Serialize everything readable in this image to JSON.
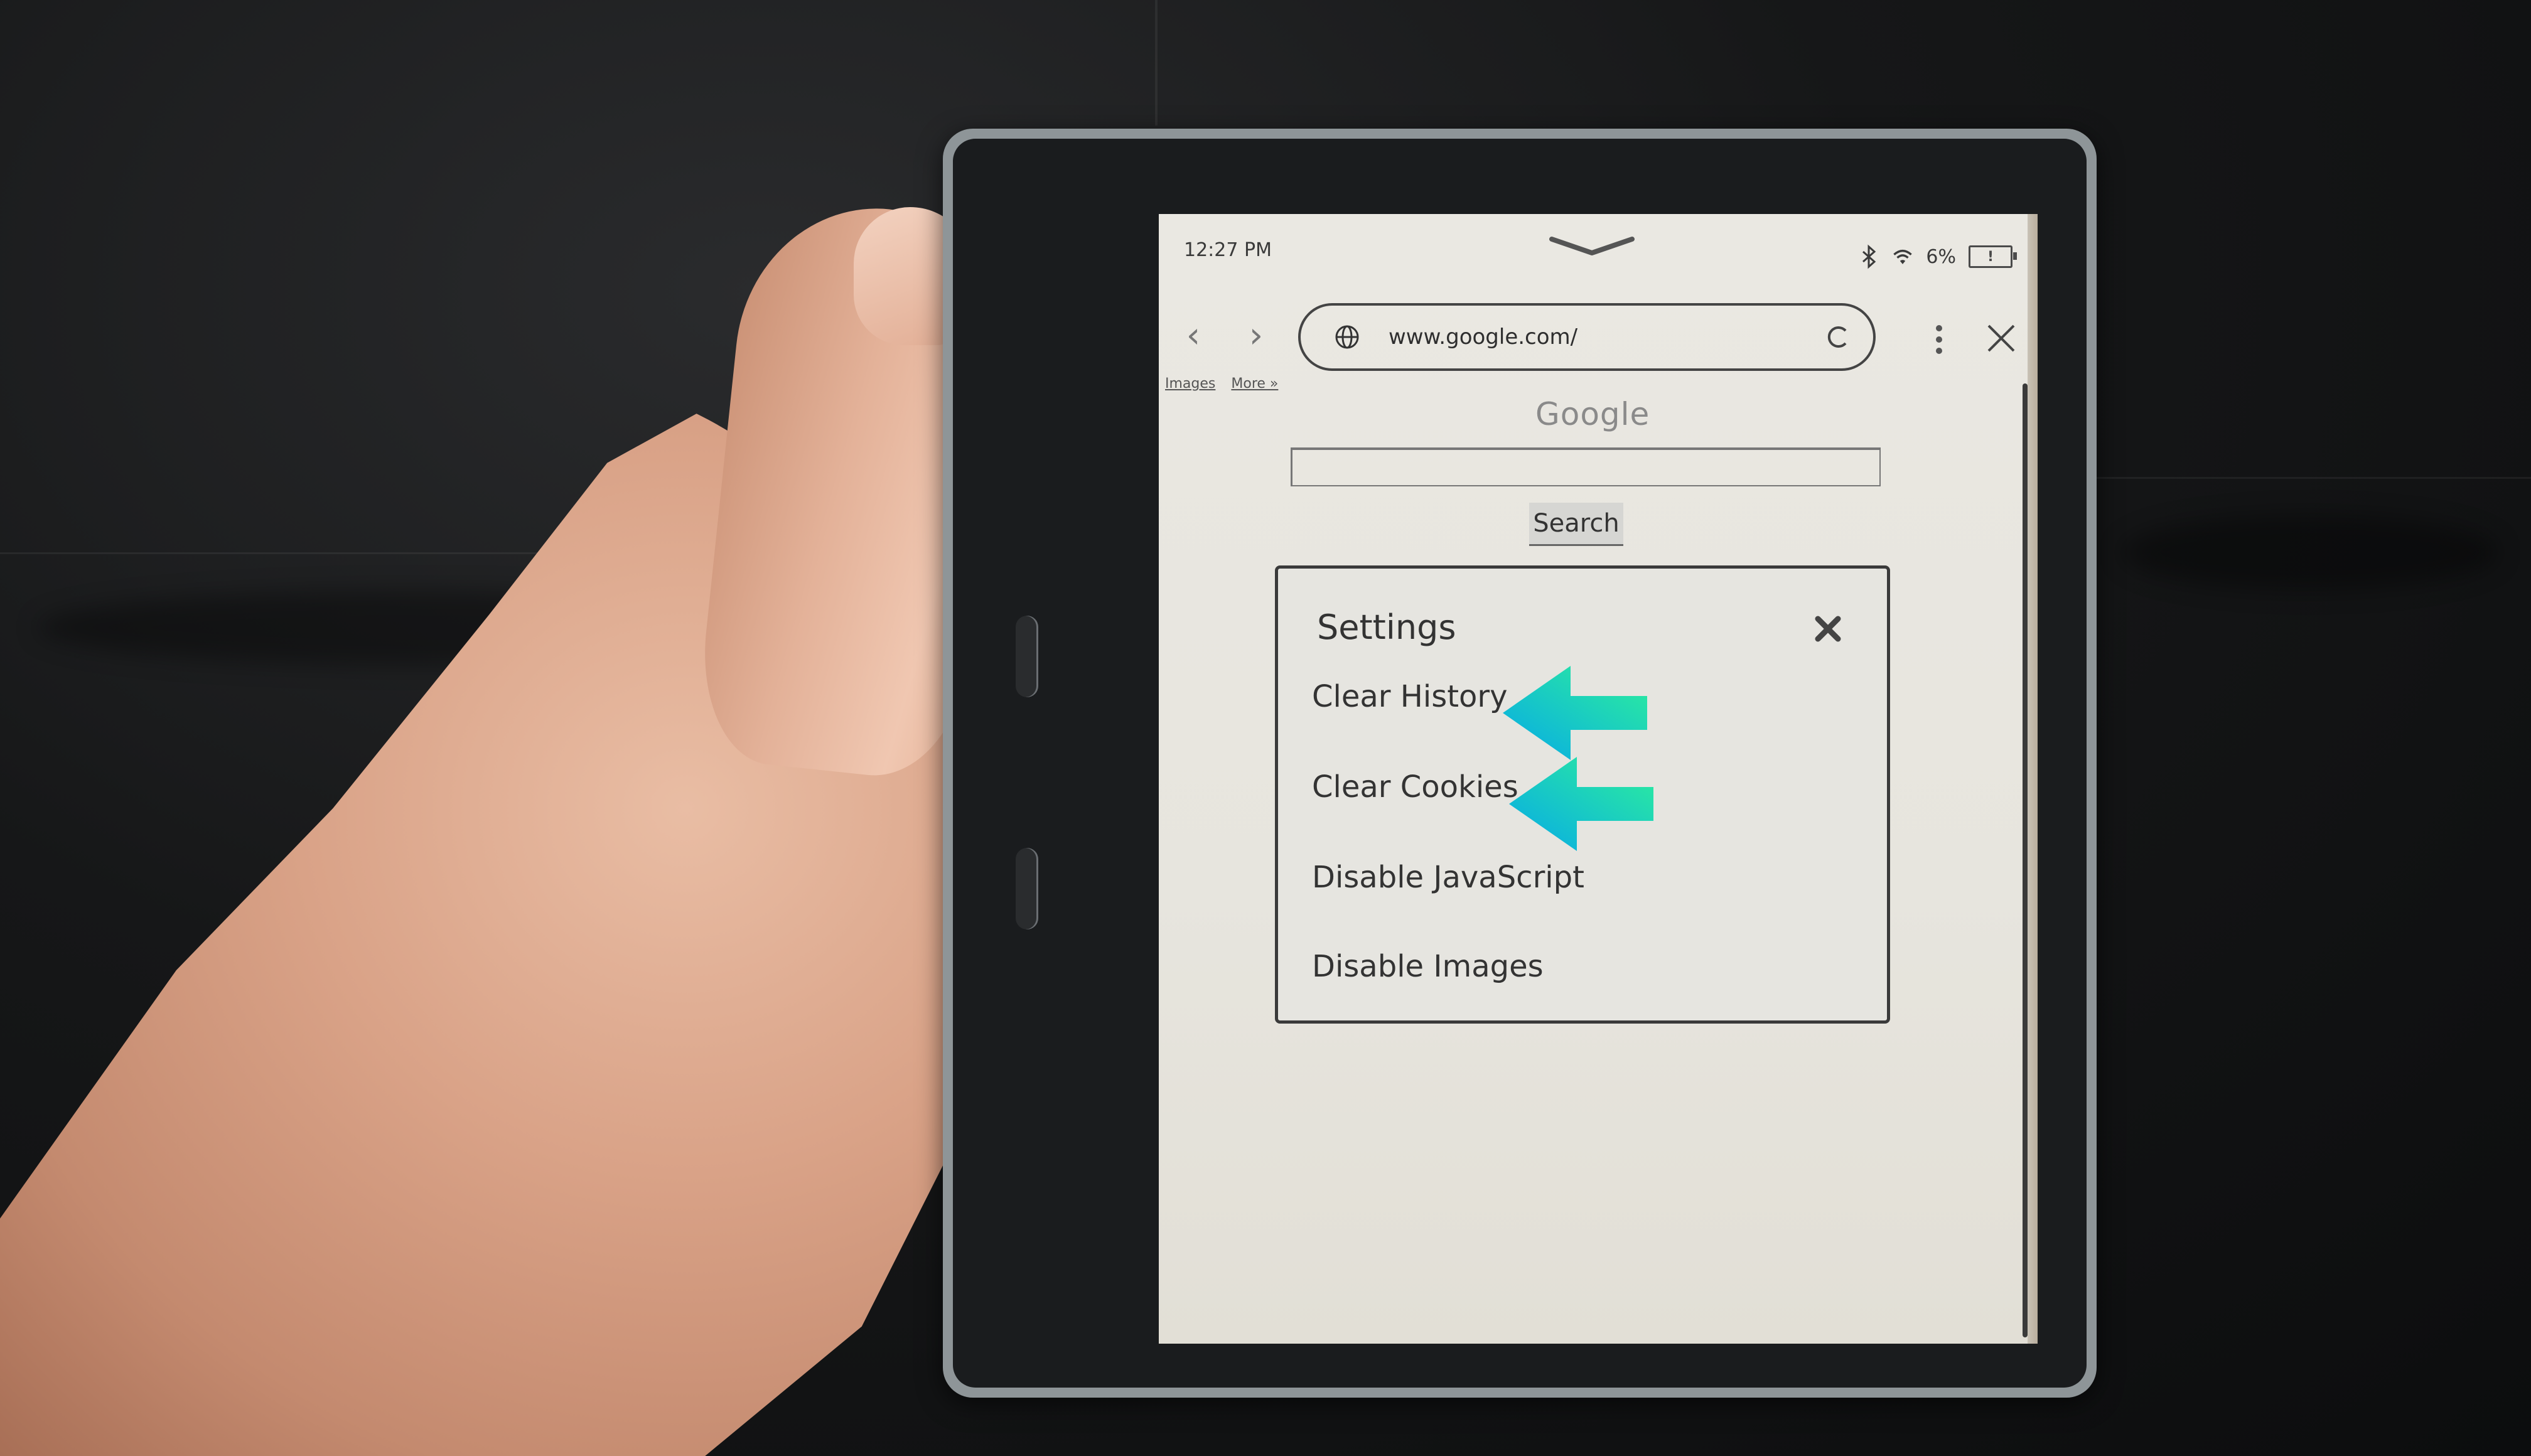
{
  "status_bar": {
    "time": "12:27 PM",
    "battery_percent": "6%",
    "battery_warning": "!",
    "icons": [
      "swipe-down-chevron-icon",
      "bluetooth-icon",
      "wifi-icon",
      "battery-low-icon"
    ]
  },
  "browser": {
    "back_icon": "chevron-left-icon",
    "forward_icon": "chevron-right-icon",
    "url": "www.google.com/",
    "url_icon": "globe-icon",
    "reload_icon": "reload-icon",
    "menu_icon": "kebab-menu-icon",
    "close_icon": "close-icon",
    "back_glyph": "‹",
    "forward_glyph": "›"
  },
  "page": {
    "top_links": [
      "Images",
      "More »"
    ],
    "logo": "Google",
    "search_input_value": "",
    "search_button": "Search"
  },
  "settings_dialog": {
    "title": "Settings",
    "close_icon": "close-x-icon",
    "items": [
      {
        "label": "Clear History",
        "highlighted": true
      },
      {
        "label": "Clear Cookies",
        "highlighted": true
      },
      {
        "label": "Disable JavaScript",
        "highlighted": false
      },
      {
        "label": "Disable Images",
        "highlighted": false
      }
    ]
  },
  "annotations": {
    "arrow_color_start": "#1ab8e0",
    "arrow_color_end": "#2ef09a"
  }
}
